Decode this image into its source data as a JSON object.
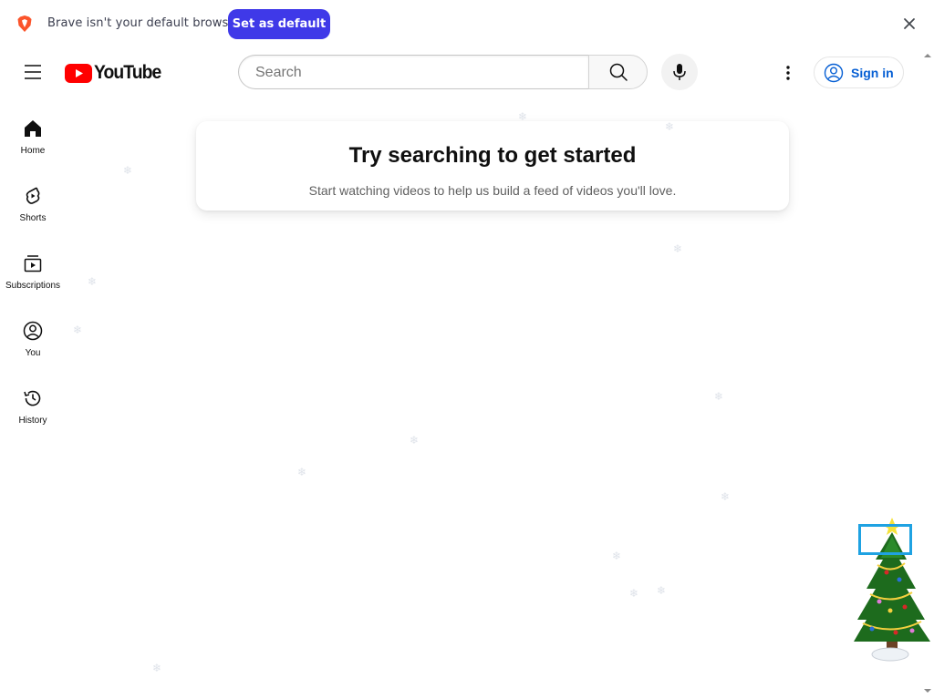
{
  "infobar": {
    "message": "Brave isn't your default browser",
    "action_label": "Set as default",
    "accent_color": "#3f39e8"
  },
  "masthead": {
    "logo_text": "YouTube",
    "search": {
      "placeholder": "Search",
      "value": ""
    },
    "signin_label": "Sign in",
    "brand_color": "#ff0000",
    "link_color": "#065fd4"
  },
  "guide": {
    "items": [
      {
        "label": "Home",
        "icon": "home-icon"
      },
      {
        "label": "Shorts",
        "icon": "shorts-icon"
      },
      {
        "label": "Subscriptions",
        "icon": "subscriptions-icon"
      },
      {
        "label": "You",
        "icon": "you-icon"
      },
      {
        "label": "History",
        "icon": "history-icon"
      }
    ]
  },
  "prompt": {
    "title": "Try searching to get started",
    "subtitle": "Start watching videos to help us build a feed of videos you'll love."
  },
  "decor": {
    "snowflake_glyph": "❄",
    "tree": "christmas-tree"
  }
}
